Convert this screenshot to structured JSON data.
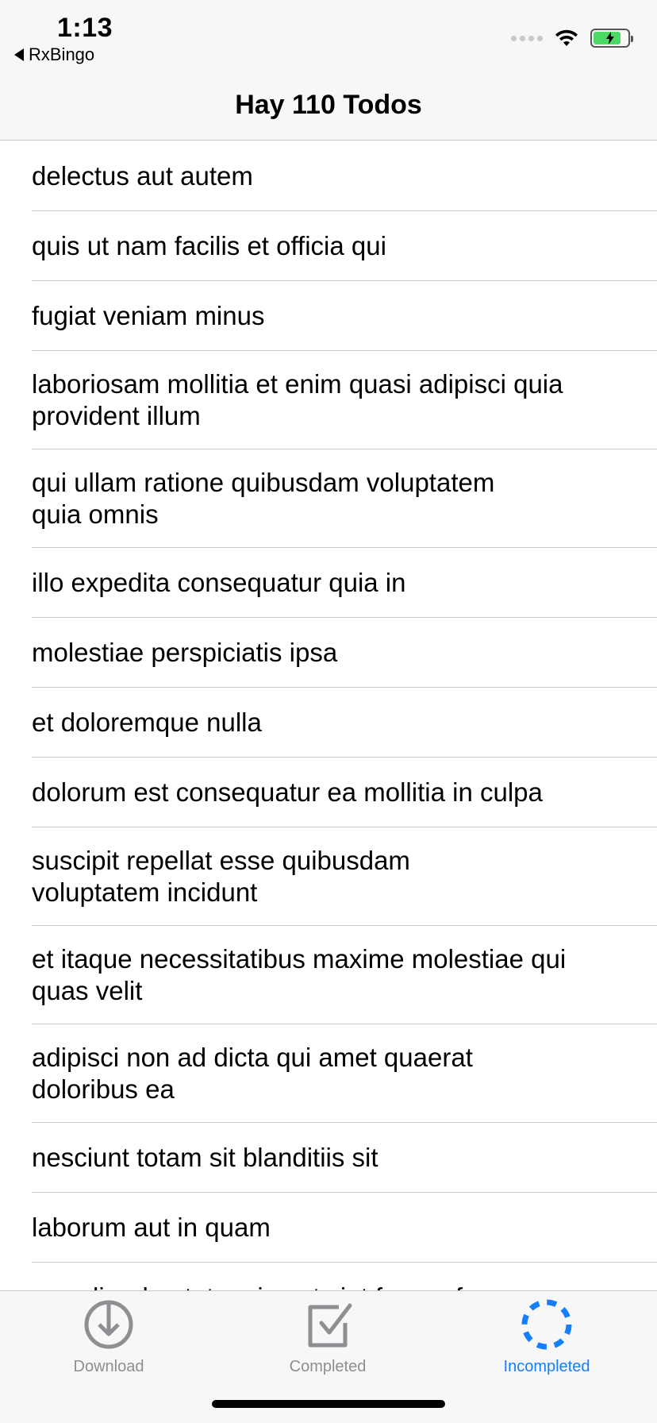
{
  "status_bar": {
    "time": "1:13",
    "back_app": "RxBingo"
  },
  "nav": {
    "title": "Hay 110 Todos"
  },
  "todos": [
    "delectus aut autem",
    "quis ut nam facilis et officia qui",
    "fugiat veniam minus",
    "laboriosam mollitia et enim quasi adipisci quia provident illum",
    "qui ullam ratione quibusdam voluptatem quia omnis",
    "illo expedita consequatur quia in",
    "molestiae perspiciatis ipsa",
    "et doloremque nulla",
    "dolorum est consequatur ea mollitia in culpa",
    "suscipit repellat esse quibusdam voluptatem incidunt",
    "et itaque necessitatibus maxime molestiae qui quas velit",
    "adipisci non ad dicta qui amet quaerat doloribus ea",
    "nesciunt totam sit blanditiis sit",
    "laborum aut in quam",
    "repudiandae totam in est sint facere fuga"
  ],
  "tabs": [
    {
      "label": "Download",
      "icon": "download-icon",
      "active": false
    },
    {
      "label": "Completed",
      "icon": "checkbox-icon",
      "active": false
    },
    {
      "label": "Incompleted",
      "icon": "dashed-circle-icon",
      "active": true
    }
  ],
  "colors": {
    "accent": "#147efb",
    "inactive": "#8e8e93",
    "separator": "#c8c7cc",
    "bar_background": "#f7f7f7"
  }
}
